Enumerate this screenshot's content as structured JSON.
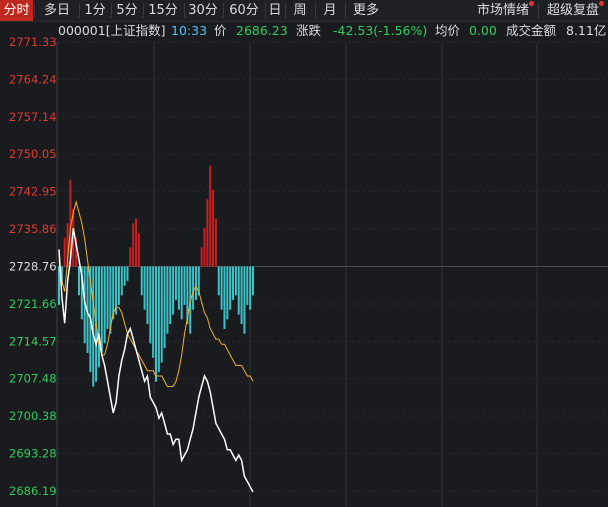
{
  "tabs": [
    {
      "label": "分时",
      "active": true
    },
    {
      "label": "多日",
      "active": false
    },
    {
      "label": "1分",
      "active": false
    },
    {
      "label": "5分",
      "active": false
    },
    {
      "label": "15分",
      "active": false
    },
    {
      "label": "30分",
      "active": false
    },
    {
      "label": "60分",
      "active": false
    },
    {
      "label": "日",
      "active": false
    },
    {
      "label": "周",
      "active": false
    },
    {
      "label": "月",
      "active": false
    },
    {
      "label": "更多",
      "active": false
    }
  ],
  "right_buttons": [
    {
      "label": "市场情绪",
      "badge": true
    },
    {
      "label": "超级复盘",
      "badge": true
    }
  ],
  "info": {
    "symbol": "000001[上证指数]",
    "time": "10:33",
    "price_label": "价",
    "price": "2686.23",
    "change_label": "涨跌",
    "change": "-42.53(-1.56%)",
    "avg_label": "均价",
    "avg": "0.00",
    "turnover_label": "成交金额",
    "turnover": "8.11亿"
  },
  "colors": {
    "up": "#e0382e",
    "down": "#2ecc5a",
    "neutral": "#dcdcdc",
    "price_line": "#ffffff",
    "avg_line": "#f0b030",
    "bar_up": "#c81e1e",
    "bar_down": "#3cc3c8",
    "accent_tab": "#c0281f"
  },
  "chart_data": {
    "type": "line",
    "prev_close": 2728.76,
    "y_ticks": [
      "2771.33",
      "2764.24",
      "2757.14",
      "2750.05",
      "2742.95",
      "2735.86",
      "2728.76",
      "2721.66",
      "2714.57",
      "2707.48",
      "2700.38",
      "2693.28",
      "2686.19"
    ],
    "ylim": [
      2686.19,
      2771.33
    ],
    "price_series": [
      2732,
      2723,
      2718,
      2726,
      2730,
      2736,
      2733,
      2730,
      2727,
      2722,
      2720,
      2719,
      2716,
      2714,
      2716,
      2712,
      2710,
      2707,
      2704,
      2701,
      2703,
      2708,
      2711,
      2713,
      2716,
      2717,
      2715,
      2713,
      2711,
      2709,
      2707,
      2708,
      2704,
      2703,
      2702,
      2700,
      2701,
      2699,
      2697,
      2697,
      2695,
      2696,
      2696,
      2692,
      2693,
      2694,
      2696,
      2698,
      2701,
      2704,
      2706,
      2708,
      2707,
      2705,
      2702,
      2699,
      2698,
      2697,
      2696,
      2694,
      2694,
      2693,
      2692,
      2693,
      2692,
      2689,
      2688,
      2687,
      2686
    ],
    "avg_series": [
      2730,
      2726,
      2724,
      2730,
      2736,
      2739,
      2741,
      2739,
      2737,
      2734,
      2730,
      2726,
      2722,
      2718,
      2714,
      2712,
      2712,
      2714,
      2717,
      2720,
      2721,
      2721,
      2720,
      2718,
      2716,
      2715,
      2714,
      2713,
      2712,
      2711,
      2710,
      2709,
      2709,
      2709,
      2708,
      2708,
      2708,
      2707,
      2706,
      2706,
      2706,
      2707,
      2709,
      2712,
      2716,
      2719,
      2722,
      2724,
      2725,
      2724,
      2722,
      2720,
      2719,
      2717,
      2716,
      2715,
      2715,
      2714,
      2714,
      2713,
      2712,
      2711,
      2710,
      2710,
      2710,
      2709,
      2708,
      2708,
      2707
    ],
    "flow_series": [
      -8,
      -4,
      6,
      9,
      18,
      12,
      6,
      -6,
      -11,
      -16,
      -18,
      -22,
      -25,
      -24,
      -21,
      -18,
      -16,
      -13,
      -14,
      -11,
      -10,
      -8,
      -6,
      -4,
      -3,
      4,
      9,
      10,
      7,
      -6,
      -9,
      -12,
      -16,
      -19,
      -24,
      -22,
      -20,
      -17,
      -14,
      -12,
      -10,
      -7,
      -9,
      -11,
      -8,
      -12,
      -14,
      -9,
      -7,
      -6,
      4,
      8,
      14,
      21,
      16,
      10,
      -6,
      -9,
      -13,
      -11,
      -9,
      -7,
      -6,
      -10,
      -12,
      -14,
      -8,
      -9,
      -6
    ]
  }
}
